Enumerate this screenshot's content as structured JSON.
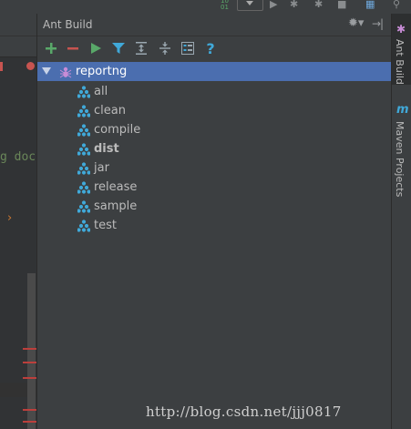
{
  "panel": {
    "title": "Ant Build",
    "toolbar": [
      {
        "name": "add-button",
        "icon": "plus-icon",
        "color": "#59a869"
      },
      {
        "name": "remove-button",
        "icon": "minus-icon",
        "color": "#c75450"
      },
      {
        "name": "run-button",
        "icon": "play-icon",
        "color": "#59a869"
      },
      {
        "name": "filter-button",
        "icon": "filter-icon",
        "color": "#40a9d9"
      },
      {
        "name": "expand-all-button",
        "icon": "expand-all-icon",
        "color": "#9aa7b0"
      },
      {
        "name": "collapse-all-button",
        "icon": "collapse-all-icon",
        "color": "#9aa7b0"
      },
      {
        "name": "properties-button",
        "icon": "properties-icon",
        "color": "#9aa7b0"
      },
      {
        "name": "help-button",
        "icon": "help-icon",
        "color": "#40a9d9"
      }
    ]
  },
  "tree": {
    "root": {
      "label": "reportng",
      "expanded": true,
      "selected": true
    },
    "targets": [
      {
        "label": "all",
        "default": false
      },
      {
        "label": "clean",
        "default": false
      },
      {
        "label": "compile",
        "default": false
      },
      {
        "label": "dist",
        "default": true
      },
      {
        "label": "jar",
        "default": false
      },
      {
        "label": "release",
        "default": false
      },
      {
        "label": "sample",
        "default": false
      },
      {
        "label": "test",
        "default": false
      }
    ]
  },
  "stripe": {
    "ant_label": "Ant Build",
    "maven_label": "Maven Projects"
  },
  "editor": {
    "snippet": "g doc"
  },
  "watermark": "http://blog.csdn.net/jjj0817"
}
